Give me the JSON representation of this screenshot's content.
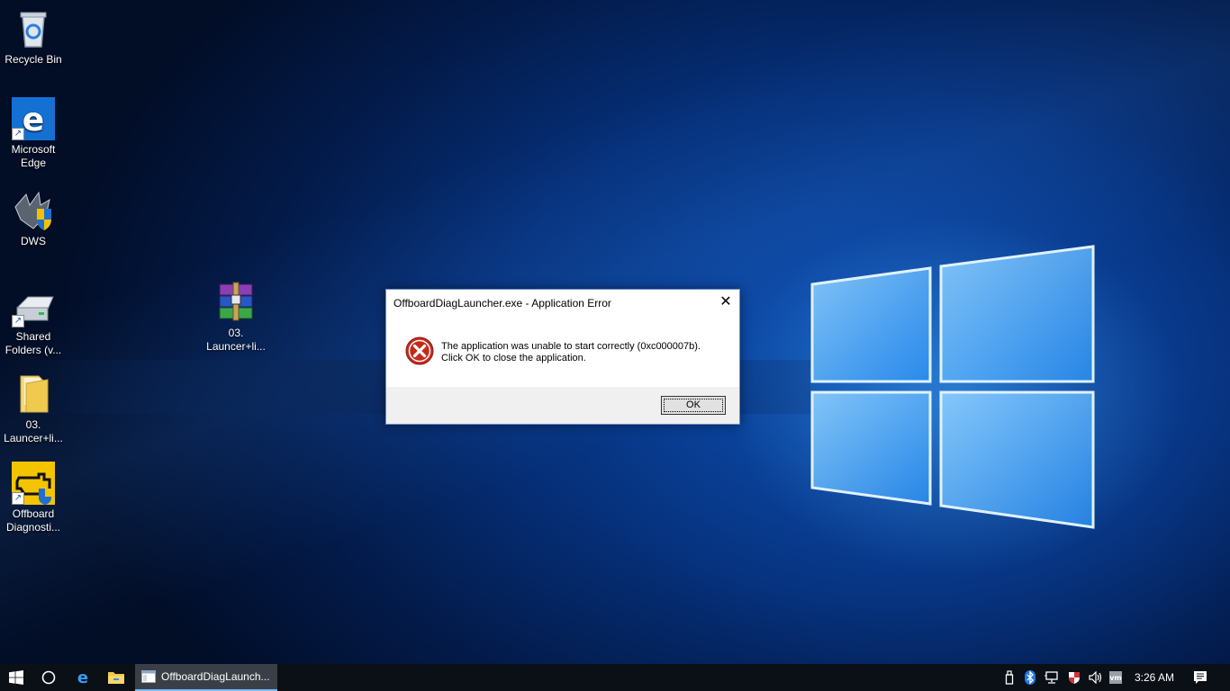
{
  "desktop": {
    "icons": [
      {
        "label": "Recycle Bin",
        "icon": "recycle-bin-icon"
      },
      {
        "label": "Microsoft Edge",
        "icon": "edge-icon"
      },
      {
        "label": "DWS",
        "icon": "dws-icon"
      },
      {
        "label": "Shared Folders (v...",
        "icon": "shared-folders-icon"
      },
      {
        "label": "03. Launcer+li...",
        "icon": "folder-icon"
      },
      {
        "label": "Offboard Diagnosti...",
        "icon": "offboard-diagnostic-icon"
      },
      {
        "label": "03. Launcer+li...",
        "icon": "winrar-archive-icon"
      }
    ]
  },
  "dialog": {
    "title": "OffboardDiagLauncher.exe - Application Error",
    "message_line1": "The application was unable to start correctly (0xc000007b).",
    "message_line2": "Click OK to close the application.",
    "ok_label": "OK",
    "close_glyph": "✕"
  },
  "taskbar": {
    "task_label": "OffboardDiagLaunch...",
    "clock": "3:26 AM",
    "tray_icons": [
      "usb-icon",
      "bluetooth-icon",
      "network-icon",
      "security-shield-icon",
      "volume-icon",
      "vmware-icon",
      "action-center-icon"
    ]
  },
  "colors": {
    "accent": "#76b9ed",
    "error": "#c42b1c",
    "taskbar": "#0b0f16"
  }
}
